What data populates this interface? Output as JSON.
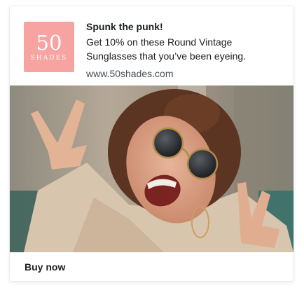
{
  "ad": {
    "logo": {
      "number": "50",
      "word": "SHADES",
      "color": "#f7a3a1"
    },
    "headline": "Spunk the punk!",
    "body_line1": "Get 10% on these Round Vintage",
    "body_line2": "Sunglasses that you’ve been eyeing.",
    "url": "www.50shades.com",
    "image_icon": "woman-sunglasses-peace-sign-photo",
    "cta_label": "Buy now"
  }
}
